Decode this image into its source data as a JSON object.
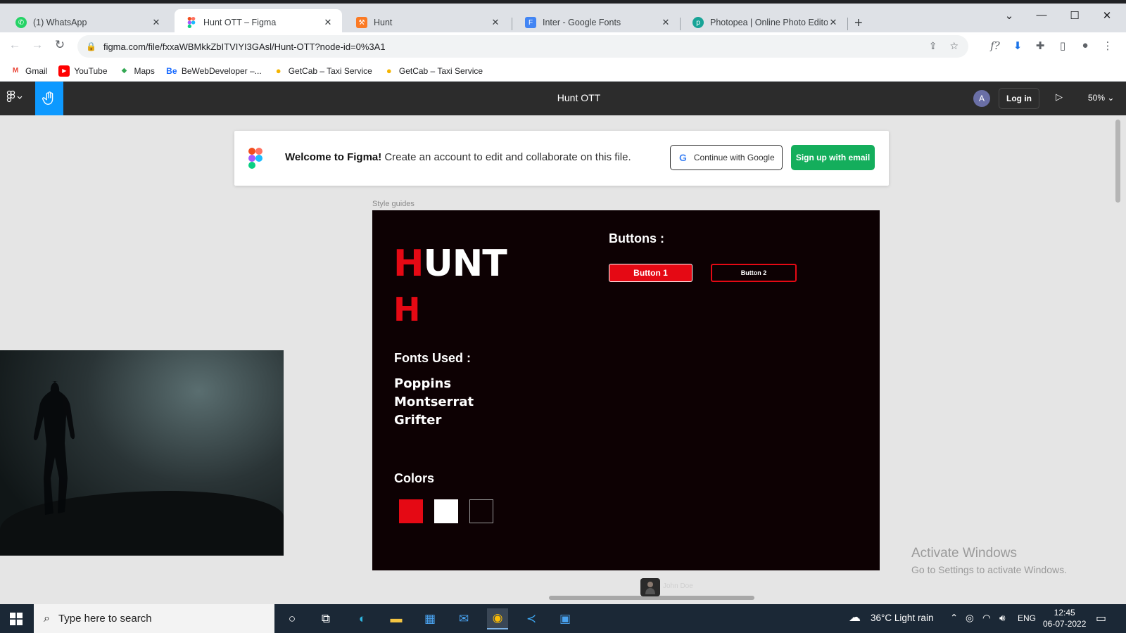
{
  "browser": {
    "tabs": [
      {
        "title": "(1) WhatsApp",
        "icon": "whatsapp-icon",
        "color": "#25d366"
      },
      {
        "title": "Hunt OTT – Figma",
        "icon": "figma-icon",
        "color": "#f24e1e"
      },
      {
        "title": "Hunt",
        "icon": "xampp-icon",
        "color": "#fb7a24"
      },
      {
        "title": "Inter - Google Fonts",
        "icon": "google-fonts-icon",
        "color": "#4285f4"
      },
      {
        "title": "Photopea | Online Photo Editor",
        "icon": "photopea-icon",
        "color": "#18a497"
      }
    ],
    "url": "figma.com/file/fxxaWBMkkZbITVIYI3GAsl/Hunt-OTT?node-id=0%3A1",
    "bookmarks": [
      {
        "label": "Gmail",
        "icon": "gmail-icon"
      },
      {
        "label": "YouTube",
        "icon": "youtube-icon"
      },
      {
        "label": "Maps",
        "icon": "maps-icon"
      },
      {
        "label": "BeWebDeveloper –...",
        "icon": "behance-icon"
      },
      {
        "label": "GetCab – Taxi Service",
        "icon": "location-pin-icon"
      },
      {
        "label": "GetCab – Taxi Service",
        "icon": "location-pin-icon"
      }
    ]
  },
  "figma": {
    "file_title": "Hunt OTT",
    "avatar_letter": "A",
    "login_label": "Log in",
    "zoom": "50%",
    "banner": {
      "bold": "Welcome to Figma!",
      "text": " Create an account to edit and collaborate on this file.",
      "google_label": "Continue with Google",
      "signup_label": "Sign up with email"
    },
    "frame_label": "Style guides",
    "style_guide": {
      "logo_first": "H",
      "logo_rest": "UNT",
      "logo_small": "H",
      "fonts_heading": "Fonts Used :",
      "fonts": [
        "Poppins",
        "Montserrat",
        "Grifter"
      ],
      "colors_heading": "Colors",
      "colors": [
        "#e50914",
        "#ffffff",
        "#0d0103"
      ],
      "buttons_heading": "Buttons :",
      "button1": "Button 1",
      "button2": "Button 2"
    },
    "cursor_user": "John Doe",
    "watermark_title": "Activate Windows",
    "watermark_sub": "Go to Settings to activate Windows."
  },
  "taskbar": {
    "search_placeholder": "Type here to search",
    "weather": "36°C  Light rain",
    "language": "ENG",
    "time": "12:45",
    "date": "06-07-2022"
  }
}
